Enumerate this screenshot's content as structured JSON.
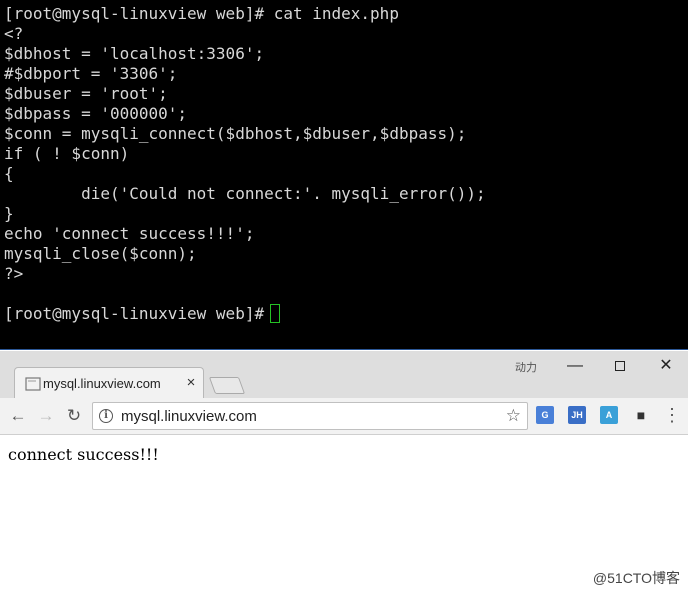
{
  "terminal": {
    "lines": [
      "[root@mysql-linuxview web]# cat index.php",
      "<?",
      "$dbhost = 'localhost:3306';",
      "#$dbport = '3306';",
      "$dbuser = 'root';",
      "$dbpass = '000000';",
      "$conn = mysqli_connect($dbhost,$dbuser,$dbpass);",
      "if ( ! $conn)",
      "{",
      "        die('Could not connect:'. mysqli_error());",
      "}",
      "echo 'connect success!!!';",
      "mysqli_close($conn);",
      "?>",
      "",
      "[root@mysql-linuxview web]#"
    ]
  },
  "browser": {
    "tab_title": "mysql.linuxview.com",
    "tab_close": "×",
    "window_label": "动力",
    "url": "mysql.linuxview.com",
    "extensions": {
      "jh": "JH",
      "a": "A"
    },
    "page_text": "connect success!!!"
  },
  "watermark": "@51CTO博客",
  "icons": {
    "back": "back-arrow-icon",
    "forward": "forward-arrow-icon",
    "reload": "reload-icon",
    "info": "info-icon",
    "star": "bookmark-star-icon",
    "menu": "menu-dots-icon"
  },
  "colors": {
    "terminal_bg": "#000000",
    "terminal_fg": "#d8d8d8",
    "cursor": "#25c225"
  }
}
